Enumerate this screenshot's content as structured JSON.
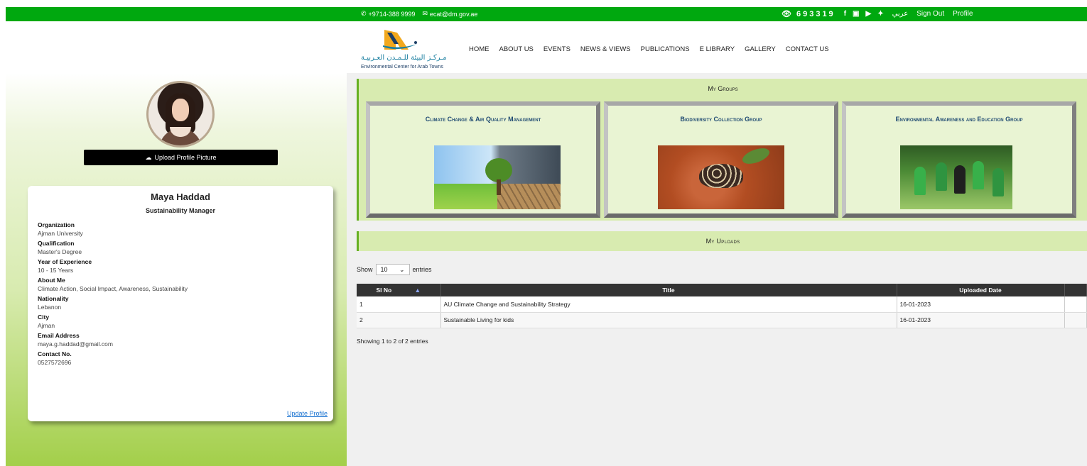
{
  "topbar": {
    "phone": "+9714-388 9999",
    "email": "ecat@dm.gov.ae",
    "visitor_counter": "693319",
    "lang_link": "عربي",
    "sign_out": "Sign Out",
    "profile": "Profile",
    "social_icons": [
      "facebook-icon",
      "instagram-icon",
      "youtube-icon",
      "twitter-icon"
    ]
  },
  "header": {
    "logo_arabic": "مـركـز البيئة للـمـدن العـربيـة",
    "logo_english": "Environmental Center for Arab Towns",
    "nav": [
      "HOME",
      "ABOUT US",
      "EVENTS",
      "NEWS & VIEWS",
      "PUBLICATIONS",
      "E LIBRARY",
      "GALLERY",
      "CONTACT US"
    ]
  },
  "profile": {
    "upload_label": "Upload Profile Picture",
    "name": "Maya Haddad",
    "role": "Sustainability Manager",
    "fields": [
      {
        "label": "Organization",
        "value": "Ajman University"
      },
      {
        "label": "Qualification",
        "value": "Master's Degree"
      },
      {
        "label": "Year of Experience",
        "value": "10 - 15 Years"
      },
      {
        "label": "About Me",
        "value": "Climate Action, Social Impact, Awareness, Sustainability"
      },
      {
        "label": "Nationality",
        "value": "Lebanon"
      },
      {
        "label": "City",
        "value": "Ajman"
      },
      {
        "label": "Email Address",
        "value": "maya.g.haddad@gmail.com"
      },
      {
        "label": "Contact No.",
        "value": "0527572696"
      }
    ],
    "update_link": "Update Profile"
  },
  "groups": {
    "title": "My Groups",
    "items": [
      {
        "name": "Climate Change & Air Quality Management"
      },
      {
        "name": "Biodiversity Collection Group"
      },
      {
        "name": "Environmental Awareness and Education Group"
      }
    ]
  },
  "uploads": {
    "title": "My Uploads",
    "show_prefix": "Show",
    "entries_value": "10",
    "show_suffix": "entries",
    "columns": [
      "Sl No",
      "Title",
      "Uploaded Date"
    ],
    "rows": [
      {
        "no": "1",
        "title": "AU Climate Change and Sustainability Strategy",
        "date": "16-01-2023"
      },
      {
        "no": "2",
        "title": "Sustainable Living for kids",
        "date": "16-01-2023"
      }
    ],
    "showing": "Showing 1 to 2 of 2 entries"
  },
  "colors": {
    "topbar": "#00a80f",
    "accent_green": "#66b022",
    "panel_green": "#d8ebb0",
    "link_blue": "#1a73d1",
    "group_title_blue": "#1f4a72"
  }
}
